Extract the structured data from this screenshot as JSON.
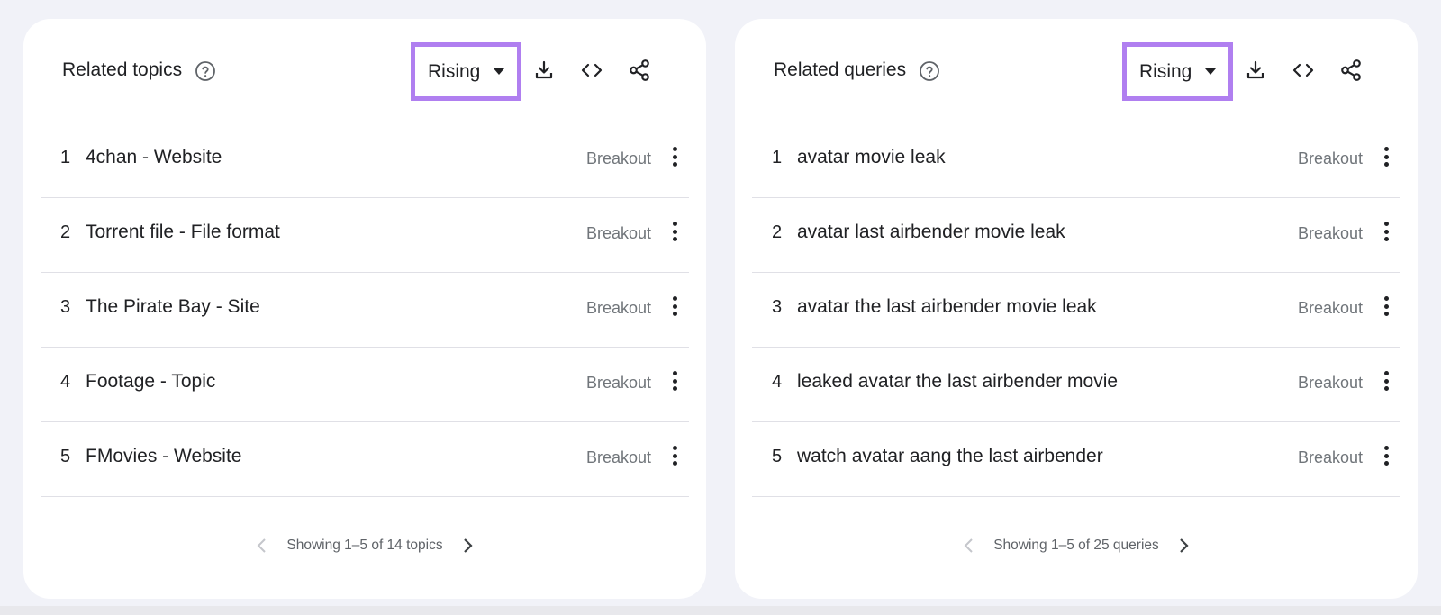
{
  "panels": [
    {
      "title": "Related topics",
      "dropdown": {
        "selected": "Rising"
      },
      "rows": [
        {
          "rank": "1",
          "label": "4chan - Website",
          "value": "Breakout"
        },
        {
          "rank": "2",
          "label": "Torrent file - File format",
          "value": "Breakout"
        },
        {
          "rank": "3",
          "label": "The Pirate Bay - Site",
          "value": "Breakout"
        },
        {
          "rank": "4",
          "label": "Footage - Topic",
          "value": "Breakout"
        },
        {
          "rank": "5",
          "label": "FMovies - Website",
          "value": "Breakout"
        }
      ],
      "pagination": "Showing 1–5 of 14 topics"
    },
    {
      "title": "Related queries",
      "dropdown": {
        "selected": "Rising"
      },
      "rows": [
        {
          "rank": "1",
          "label": "avatar movie leak",
          "value": "Breakout"
        },
        {
          "rank": "2",
          "label": "avatar last airbender movie leak",
          "value": "Breakout"
        },
        {
          "rank": "3",
          "label": "avatar the last airbender movie leak",
          "value": "Breakout"
        },
        {
          "rank": "4",
          "label": "leaked avatar the last airbender movie",
          "value": "Breakout"
        },
        {
          "rank": "5",
          "label": "watch avatar aang the last airbender",
          "value": "Breakout"
        }
      ],
      "pagination": "Showing 1–5 of 25 queries"
    }
  ],
  "colors": {
    "background": "#f1f2f8",
    "card": "#ffffff",
    "highlight_border": "#b07ff0",
    "breakout_text": "#70757a"
  },
  "icons": {
    "help": "help-circle-icon",
    "download": "download-icon",
    "embed": "code-icon",
    "share": "share-icon",
    "row_menu": "more-vertical-icon",
    "prev": "chevron-left-icon",
    "next": "chevron-right-icon"
  }
}
